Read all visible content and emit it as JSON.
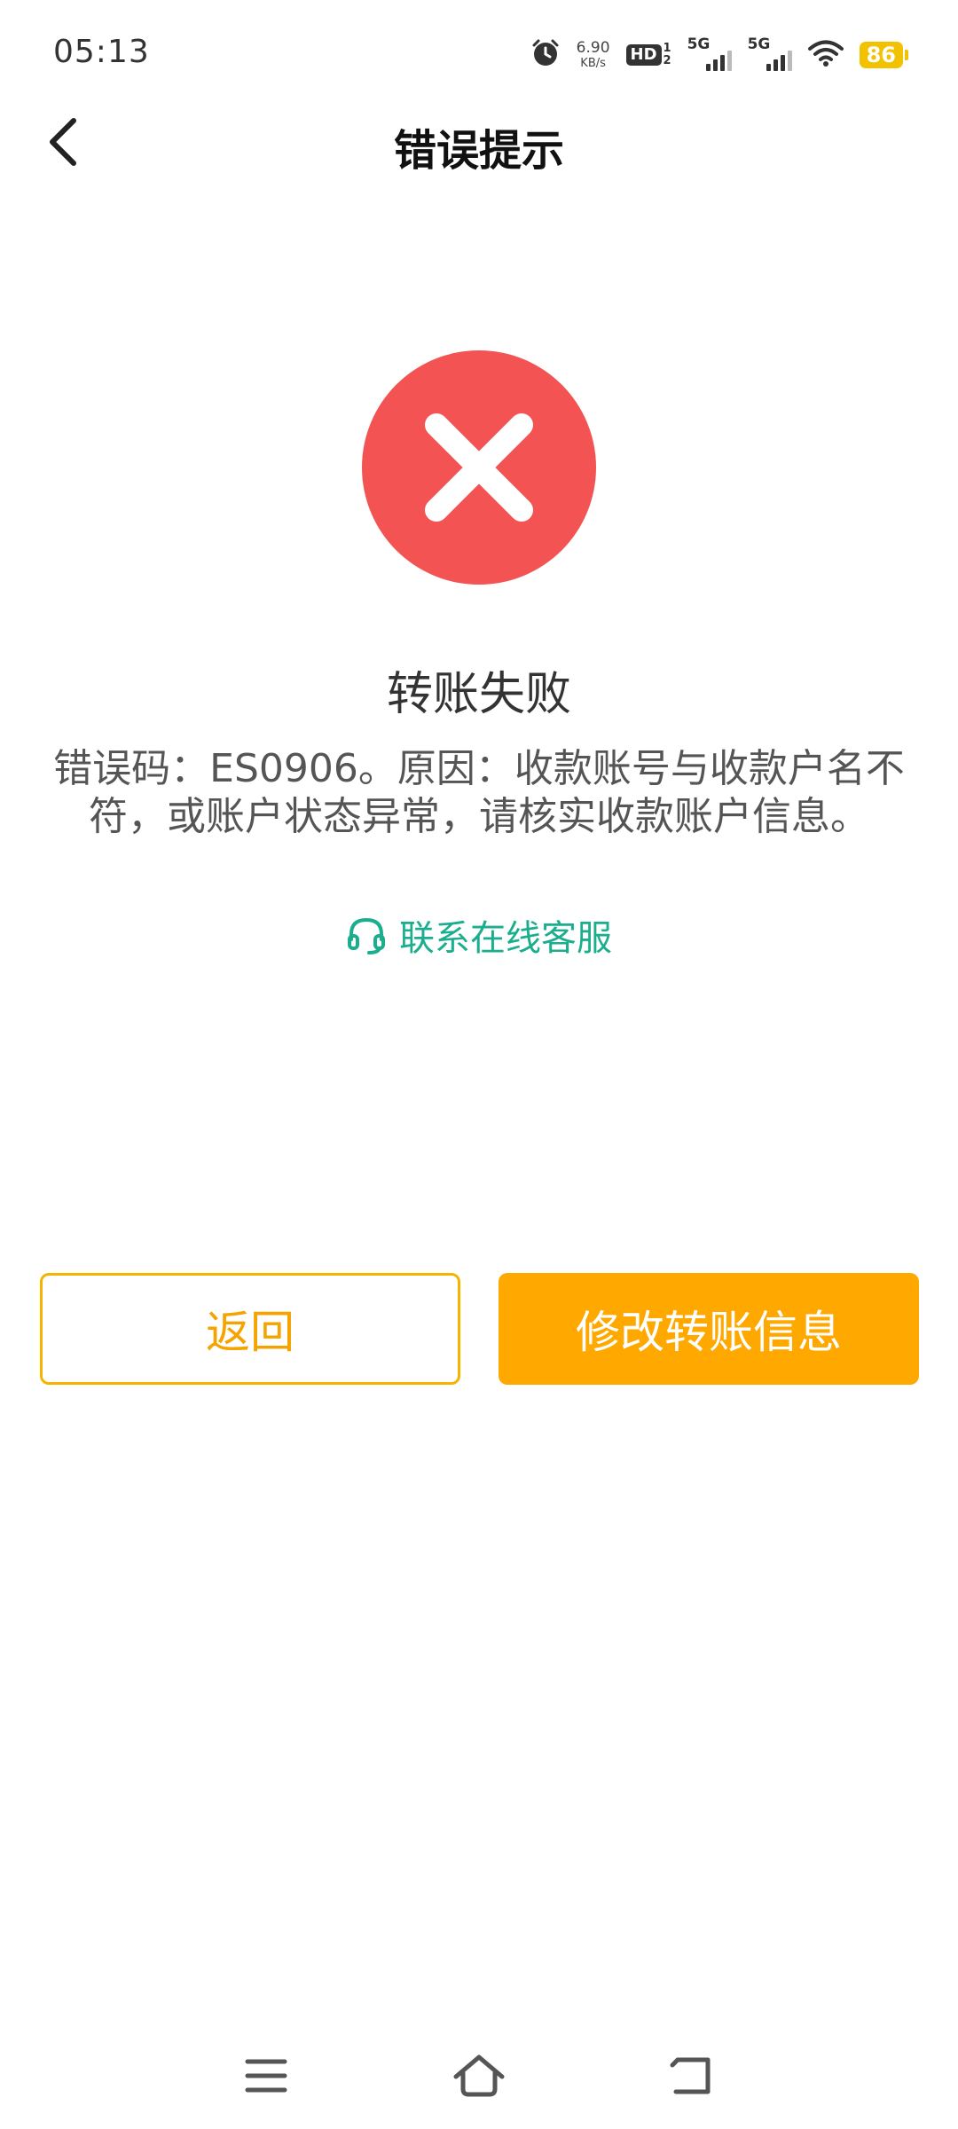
{
  "status_bar": {
    "time": "05:13",
    "net_speed_value": "6.90",
    "net_speed_unit": "KB/s",
    "hd_label": "HD",
    "hd_top": "1",
    "hd_bottom": "2",
    "sim1_label": "5G",
    "sim2_label": "5G",
    "battery": "86",
    "icons": [
      "alarm-icon",
      "hd-icon",
      "signal-icon",
      "signal-icon",
      "wifi-icon",
      "battery-icon"
    ]
  },
  "nav": {
    "title": "错误提示",
    "back_icon": "chevron-left-icon"
  },
  "result": {
    "icon": "close-circle-icon",
    "title": "转账失败",
    "message_line1": "错误码：ES0906。原因：收款账号与收款户名不",
    "message_line2": "符，或账户状态异常，请核实收款账户信息。",
    "support_label": "联系在线客服",
    "support_icon": "headset-icon"
  },
  "buttons": {
    "return_label": "返回",
    "modify_label": "修改转账信息"
  },
  "system_nav": {
    "icons": [
      "menu-icon",
      "home-icon",
      "back-icon"
    ]
  },
  "colors": {
    "error_red": "#f35353",
    "primary_orange": "#ffa800",
    "support_green": "#1aae8e",
    "battery_yellow": "#f2c200"
  }
}
